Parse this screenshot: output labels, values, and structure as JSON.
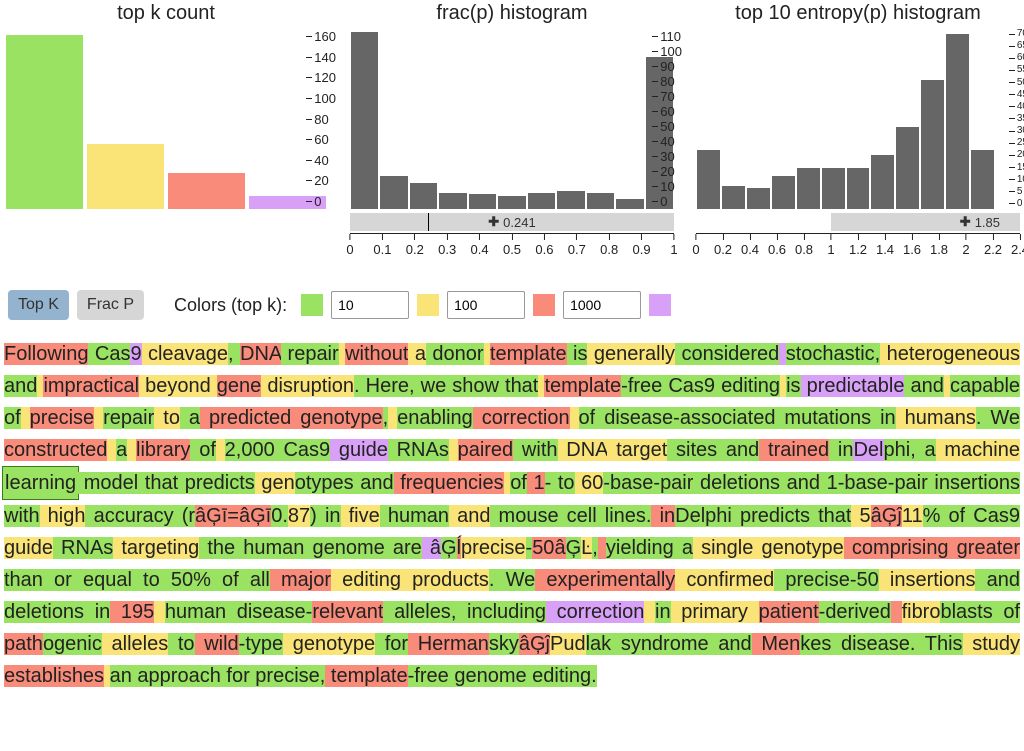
{
  "chart_data": [
    {
      "type": "bar",
      "title": "top k count",
      "categories": [
        "≤10",
        "≤100",
        "≤1000",
        ">1000"
      ],
      "values": [
        155,
        58,
        32,
        12
      ],
      "colors": [
        "#9ae261",
        "#fae377",
        "#f98b7b",
        "#d8a1f7"
      ],
      "ylim": [
        0,
        160
      ],
      "yticks": [
        0,
        20,
        40,
        60,
        80,
        100,
        120,
        140,
        160
      ]
    },
    {
      "type": "histogram",
      "title": "frac(p) histogram",
      "x": [
        0,
        0.1,
        0.2,
        0.3,
        0.4,
        0.5,
        0.6,
        0.7,
        0.8,
        0.9,
        1.0
      ],
      "values": [
        108,
        20,
        16,
        10,
        9,
        8,
        10,
        11,
        10,
        6,
        93
      ],
      "ylim": [
        0,
        110
      ],
      "yticks": [
        0,
        10,
        20,
        30,
        40,
        50,
        60,
        70,
        80,
        90,
        100,
        110
      ],
      "slider_value": 0.241
    },
    {
      "type": "histogram",
      "title": "top 10 entropy(p) histogram",
      "x": [
        0,
        0.2,
        0.4,
        0.6,
        0.8,
        1.0,
        1.2,
        1.4,
        1.6,
        1.8,
        2.0,
        2.2,
        2.4
      ],
      "values": [
        23,
        9,
        8,
        13,
        16,
        16,
        16,
        21,
        32,
        50,
        68,
        23,
        0
      ],
      "ylim": [
        0,
        70
      ],
      "yticks": [
        0,
        5,
        10,
        15,
        20,
        25,
        30,
        35,
        40,
        45,
        50,
        55,
        60,
        65,
        70
      ],
      "slider_value": 1.85,
      "slider_range": [
        1.0,
        2.4
      ]
    }
  ],
  "controls": {
    "top_k_label": "Top K",
    "frac_p_label": "Frac P",
    "colors_label": "Colors (top k):",
    "thresholds": [
      "10",
      "100",
      "1000"
    ],
    "swatches": [
      "#9ae261",
      "#fae377",
      "#f98b7b",
      "#d8a1f7"
    ]
  },
  "text": {
    "tokens": [
      [
        "Following",
        "r"
      ],
      [
        " ",
        "g"
      ],
      [
        "Cas",
        "g"
      ],
      [
        "9",
        "p"
      ],
      [
        " cleavage",
        "y"
      ],
      [
        ",",
        "g"
      ],
      [
        " ",
        "g"
      ],
      [
        "DNA",
        "r"
      ],
      [
        " repair",
        "g"
      ],
      [
        " ",
        "y"
      ],
      [
        "without",
        "r"
      ],
      [
        " a",
        "y"
      ],
      [
        " donor",
        "g"
      ],
      [
        " ",
        "y"
      ],
      [
        "template",
        "r"
      ],
      [
        " is",
        "g"
      ],
      [
        " generally",
        "y"
      ],
      [
        " ",
        "g"
      ],
      [
        "considered",
        "g"
      ],
      [
        " ",
        "p"
      ],
      [
        "st",
        "g"
      ],
      [
        "ochastic",
        "g"
      ],
      [
        ",",
        "g"
      ],
      [
        " heterogeneous",
        "y"
      ],
      [
        " and",
        "g"
      ],
      [
        " ",
        "y"
      ],
      [
        "impr",
        "r"
      ],
      [
        "actical",
        "r"
      ],
      [
        " beyond",
        "y"
      ],
      [
        " ",
        "y"
      ],
      [
        "gene",
        "r"
      ],
      [
        " disruption",
        "y"
      ],
      [
        ".",
        "g"
      ],
      [
        " Here",
        "g"
      ],
      [
        ",",
        "g"
      ],
      [
        " we",
        "g"
      ],
      [
        " show",
        "g"
      ],
      [
        " that",
        "g"
      ],
      [
        " ",
        "y"
      ],
      [
        "template",
        "r"
      ],
      [
        "-",
        "g"
      ],
      [
        "free",
        "g"
      ],
      [
        " Cas",
        "g"
      ],
      [
        "9",
        "g"
      ],
      [
        " editing",
        "g"
      ],
      [
        " ",
        "y"
      ],
      [
        "is",
        "g"
      ],
      [
        " ",
        "p"
      ],
      [
        "predictable",
        "p"
      ],
      [
        " and",
        "g"
      ],
      [
        " ",
        "y"
      ],
      [
        "capable",
        "g"
      ],
      [
        " of",
        "g"
      ],
      [
        " ",
        "y"
      ],
      [
        "precise",
        "r"
      ],
      [
        " ",
        "y"
      ],
      [
        "repair",
        "g"
      ],
      [
        " to",
        "y"
      ],
      [
        " ",
        "g"
      ],
      [
        "a",
        "g"
      ],
      [
        " ",
        "r"
      ],
      [
        "predicted",
        "r"
      ],
      [
        " genotype",
        "r"
      ],
      [
        ",",
        "g"
      ],
      [
        " ",
        "y"
      ],
      [
        "enabling",
        "g"
      ],
      [
        " ",
        "r"
      ],
      [
        "correction",
        "r"
      ],
      [
        " ",
        "y"
      ],
      [
        "of",
        "g"
      ],
      [
        " disease",
        "g"
      ],
      [
        "-",
        "g"
      ],
      [
        "associated",
        "g"
      ],
      [
        " mutations",
        "g"
      ],
      [
        " in",
        "g"
      ],
      [
        " humans",
        "y"
      ],
      [
        ".",
        "g"
      ],
      [
        " We",
        "g"
      ],
      [
        " ",
        "r"
      ],
      [
        "constructed",
        "r"
      ],
      [
        " ",
        "y"
      ],
      [
        "a",
        "g"
      ],
      [
        " ",
        "y"
      ],
      [
        "library",
        "r"
      ],
      [
        " of",
        "g"
      ],
      [
        " ",
        "y"
      ],
      [
        "2",
        "g"
      ],
      [
        ",",
        "g"
      ],
      [
        "000",
        "g"
      ],
      [
        " Cas",
        "g"
      ],
      [
        "9",
        "g"
      ],
      [
        " ",
        "p"
      ],
      [
        "guide",
        "p"
      ],
      [
        " RN",
        "g"
      ],
      [
        "As",
        "g"
      ],
      [
        " ",
        "y"
      ],
      [
        "paired",
        "r"
      ],
      [
        " with",
        "g"
      ],
      [
        " DNA",
        "y"
      ],
      [
        " target",
        "y"
      ],
      [
        " sites",
        "g"
      ],
      [
        " and",
        "g"
      ],
      [
        " ",
        "r"
      ],
      [
        "trained",
        "r"
      ],
      [
        " in",
        "g"
      ],
      [
        "Del",
        "p"
      ],
      [
        "phi",
        "g"
      ],
      [
        ",",
        "g"
      ],
      [
        " a",
        "g"
      ],
      [
        " machine",
        "y"
      ],
      [
        " learning",
        "g",
        true
      ],
      [
        " model",
        "g"
      ],
      [
        " that",
        "g"
      ],
      [
        " predicts",
        "g"
      ],
      [
        " gen",
        "y"
      ],
      [
        "otypes",
        "g"
      ],
      [
        " and",
        "g"
      ],
      [
        " ",
        "r"
      ],
      [
        "frequencies",
        "r"
      ],
      [
        " ",
        "y"
      ],
      [
        "of",
        "g"
      ],
      [
        " ",
        "r"
      ],
      [
        "1",
        "r"
      ],
      [
        "-",
        "g"
      ],
      [
        " to",
        "g"
      ],
      [
        " 60",
        "y"
      ],
      [
        "-",
        "g"
      ],
      [
        "base",
        "g"
      ],
      [
        "-",
        "g"
      ],
      [
        "pair",
        "g"
      ],
      [
        " deletions",
        "g"
      ],
      [
        " and",
        "g"
      ],
      [
        " 1",
        "g"
      ],
      [
        "-",
        "g"
      ],
      [
        "base",
        "g"
      ],
      [
        "-",
        "g"
      ],
      [
        "pair",
        "g"
      ],
      [
        " insertions",
        "g"
      ],
      [
        " with",
        "g"
      ],
      [
        " high",
        "y"
      ],
      [
        " accuracy",
        "g"
      ],
      [
        " (",
        "g"
      ],
      [
        "r",
        "g"
      ],
      [
        "â",
        "r"
      ],
      [
        "Ģ",
        "r"
      ],
      [
        "ī",
        "r"
      ],
      [
        "=",
        "r"
      ],
      [
        "â",
        "r"
      ],
      [
        "Ģ",
        "r"
      ],
      [
        "ī",
        "r"
      ],
      [
        "0",
        "g"
      ],
      [
        ".",
        "g"
      ],
      [
        "87",
        "y"
      ],
      [
        ")",
        "g"
      ],
      [
        " in",
        "g"
      ],
      [
        " five",
        "y"
      ],
      [
        " human",
        "g"
      ],
      [
        " and",
        "y"
      ],
      [
        " mouse",
        "g"
      ],
      [
        " cell",
        "g"
      ],
      [
        " lines",
        "g"
      ],
      [
        ".",
        "g"
      ],
      [
        " ",
        "r"
      ],
      [
        "in",
        "r"
      ],
      [
        "Del",
        "g"
      ],
      [
        "phi",
        "g"
      ],
      [
        " predicts",
        "g"
      ],
      [
        " that",
        "g"
      ],
      [
        " 5",
        "y"
      ],
      [
        "â",
        "r"
      ],
      [
        "Ģ",
        "r"
      ],
      [
        "ĵ",
        "r"
      ],
      [
        "11",
        "y"
      ],
      [
        "%",
        "g"
      ],
      [
        " of",
        "g"
      ],
      [
        " Cas",
        "g"
      ],
      [
        "9",
        "g"
      ],
      [
        " ",
        "y"
      ],
      [
        "guide",
        "y"
      ],
      [
        " RN",
        "g"
      ],
      [
        "As",
        "g"
      ],
      [
        " targeting",
        "y"
      ],
      [
        " the",
        "g"
      ],
      [
        " human",
        "g"
      ],
      [
        " genome",
        "g"
      ],
      [
        " are",
        "g"
      ],
      [
        " ",
        "p"
      ],
      [
        "â",
        "p"
      ],
      [
        "Ģ",
        "g"
      ],
      [
        "ĺ",
        "r"
      ],
      [
        "precise",
        "y"
      ],
      [
        "-",
        "g"
      ],
      [
        "50",
        "r"
      ],
      [
        "â",
        "r"
      ],
      [
        "Ģ",
        "g"
      ],
      [
        "Ŀ",
        "y"
      ],
      [
        ",",
        "g"
      ],
      [
        " ",
        "r"
      ],
      [
        "yielding",
        "g"
      ],
      [
        " a",
        "g"
      ],
      [
        " single",
        "y"
      ],
      [
        " genotype",
        "y"
      ],
      [
        " ",
        "r"
      ],
      [
        "comprising",
        "r"
      ],
      [
        " ",
        "r"
      ],
      [
        "greater",
        "r"
      ],
      [
        " than",
        "g"
      ],
      [
        " or",
        "g"
      ],
      [
        " equal",
        "g"
      ],
      [
        " to",
        "g"
      ],
      [
        " 50",
        "g"
      ],
      [
        "%",
        "g"
      ],
      [
        " of",
        "g"
      ],
      [
        " all",
        "g"
      ],
      [
        " ",
        "r"
      ],
      [
        "major",
        "r"
      ],
      [
        " editing",
        "y"
      ],
      [
        " products",
        "y"
      ],
      [
        ".",
        "g"
      ],
      [
        " We",
        "g"
      ],
      [
        " ",
        "r"
      ],
      [
        "experimentally",
        "r"
      ],
      [
        " confirmed",
        "y"
      ],
      [
        " precise",
        "g"
      ],
      [
        "-",
        "g"
      ],
      [
        "50",
        "g"
      ],
      [
        " insertions",
        "y"
      ],
      [
        " and",
        "g"
      ],
      [
        " deletions",
        "g"
      ],
      [
        " in",
        "g"
      ],
      [
        " ",
        "r"
      ],
      [
        "195",
        "r"
      ],
      [
        " ",
        "y"
      ],
      [
        "human",
        "g"
      ],
      [
        " disease",
        "g"
      ],
      [
        "-",
        "g"
      ],
      [
        "relevant",
        "r"
      ],
      [
        " alleles",
        "g"
      ],
      [
        ",",
        "g"
      ],
      [
        " including",
        "g"
      ],
      [
        " ",
        "p"
      ],
      [
        "correction",
        "p"
      ],
      [
        " ",
        "y"
      ],
      [
        "in",
        "g"
      ],
      [
        " primary",
        "y"
      ],
      [
        " ",
        "y"
      ],
      [
        "patient",
        "r"
      ],
      [
        "-",
        "g"
      ],
      [
        "derived",
        "g"
      ],
      [
        " ",
        "r"
      ],
      [
        "fibro",
        "y"
      ],
      [
        "blasts",
        "g"
      ],
      [
        " of",
        "g"
      ],
      [
        " ",
        "r"
      ],
      [
        "path",
        "r"
      ],
      [
        "ogenic",
        "g"
      ],
      [
        " alleles",
        "y"
      ],
      [
        " to",
        "g"
      ],
      [
        " ",
        "r"
      ],
      [
        "wild",
        "r"
      ],
      [
        "-",
        "g"
      ],
      [
        "type",
        "g"
      ],
      [
        " genotype",
        "y"
      ],
      [
        " for",
        "g"
      ],
      [
        " ",
        "r"
      ],
      [
        "Herman",
        "r"
      ],
      [
        "sky",
        "g"
      ],
      [
        "â",
        "r"
      ],
      [
        "Ģ",
        "r"
      ],
      [
        "ĵ",
        "r"
      ],
      [
        "Pud",
        "y"
      ],
      [
        "lak",
        "g"
      ],
      [
        " syndrome",
        "g"
      ],
      [
        " and",
        "g"
      ],
      [
        " ",
        "r"
      ],
      [
        "Men",
        "r"
      ],
      [
        "kes",
        "g"
      ],
      [
        " disease",
        "g"
      ],
      [
        ".",
        "g"
      ],
      [
        " This",
        "g"
      ],
      [
        " study",
        "y"
      ],
      [
        " ",
        "y"
      ],
      [
        "establishes",
        "r"
      ],
      [
        " ",
        "y"
      ],
      [
        "an",
        "g"
      ],
      [
        " approach",
        "g"
      ],
      [
        " for",
        "g"
      ],
      [
        " precise",
        "g"
      ],
      [
        ",",
        "g"
      ],
      [
        " ",
        "r"
      ],
      [
        "template",
        "r"
      ],
      [
        "-",
        "g"
      ],
      [
        "free",
        "g"
      ],
      [
        " genome",
        "g"
      ],
      [
        " editing",
        "g"
      ],
      [
        ".",
        "g"
      ]
    ]
  }
}
